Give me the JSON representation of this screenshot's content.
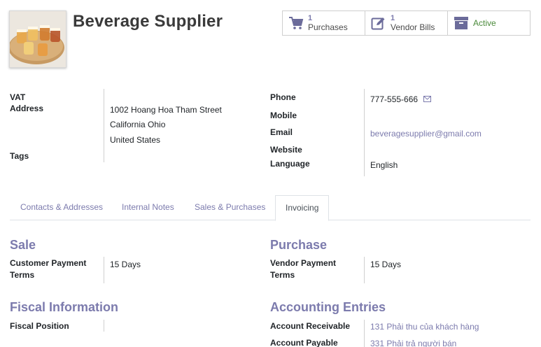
{
  "partner": {
    "name": "Beverage Supplier"
  },
  "smart_buttons": {
    "purchases": {
      "count": "1",
      "label": "Purchases",
      "icon": "cart-icon"
    },
    "vendor_bills": {
      "count": "1",
      "label": "Vendor Bills",
      "icon": "edit-icon"
    },
    "active": {
      "label": "Active",
      "icon": "archive-icon"
    }
  },
  "fields_left": {
    "vat_label": "VAT",
    "address_label": "Address",
    "address_line1": "1002 Hoang Hoa Tham Street",
    "address_line2": "California Ohio",
    "address_line3": "United States",
    "tags_label": "Tags"
  },
  "fields_right": {
    "phone_label": "Phone",
    "phone_value": "777-555-666",
    "mobile_label": "Mobile",
    "email_label": "Email",
    "email_value": "beveragesupplier@gmail.com",
    "website_label": "Website",
    "language_label": "Language",
    "language_value": "English"
  },
  "tabs": [
    {
      "label": "Contacts & Addresses"
    },
    {
      "label": "Internal Notes"
    },
    {
      "label": "Sales & Purchases"
    },
    {
      "label": "Invoicing",
      "active": true
    }
  ],
  "invoicing": {
    "sale_title": "Sale",
    "customer_payment_terms_label_1": "Customer Payment",
    "customer_payment_terms_label_2": "Terms",
    "customer_payment_terms_value": "15 Days",
    "purchase_title": "Purchase",
    "vendor_payment_terms_label_1": "Vendor Payment",
    "vendor_payment_terms_label_2": "Terms",
    "vendor_payment_terms_value": "15 Days",
    "fiscal_title": "Fiscal Information",
    "fiscal_position_label": "Fiscal Position",
    "accounting_title": "Accounting Entries",
    "account_receivable_label": "Account Receivable",
    "account_receivable_value": "131 Phải thu của khách hàng",
    "account_payable_label": "Account Payable",
    "account_payable_value": "331 Phải trả người bán"
  },
  "colors": {
    "accent": "#7c7bad",
    "active_green": "#4a8a3a"
  }
}
